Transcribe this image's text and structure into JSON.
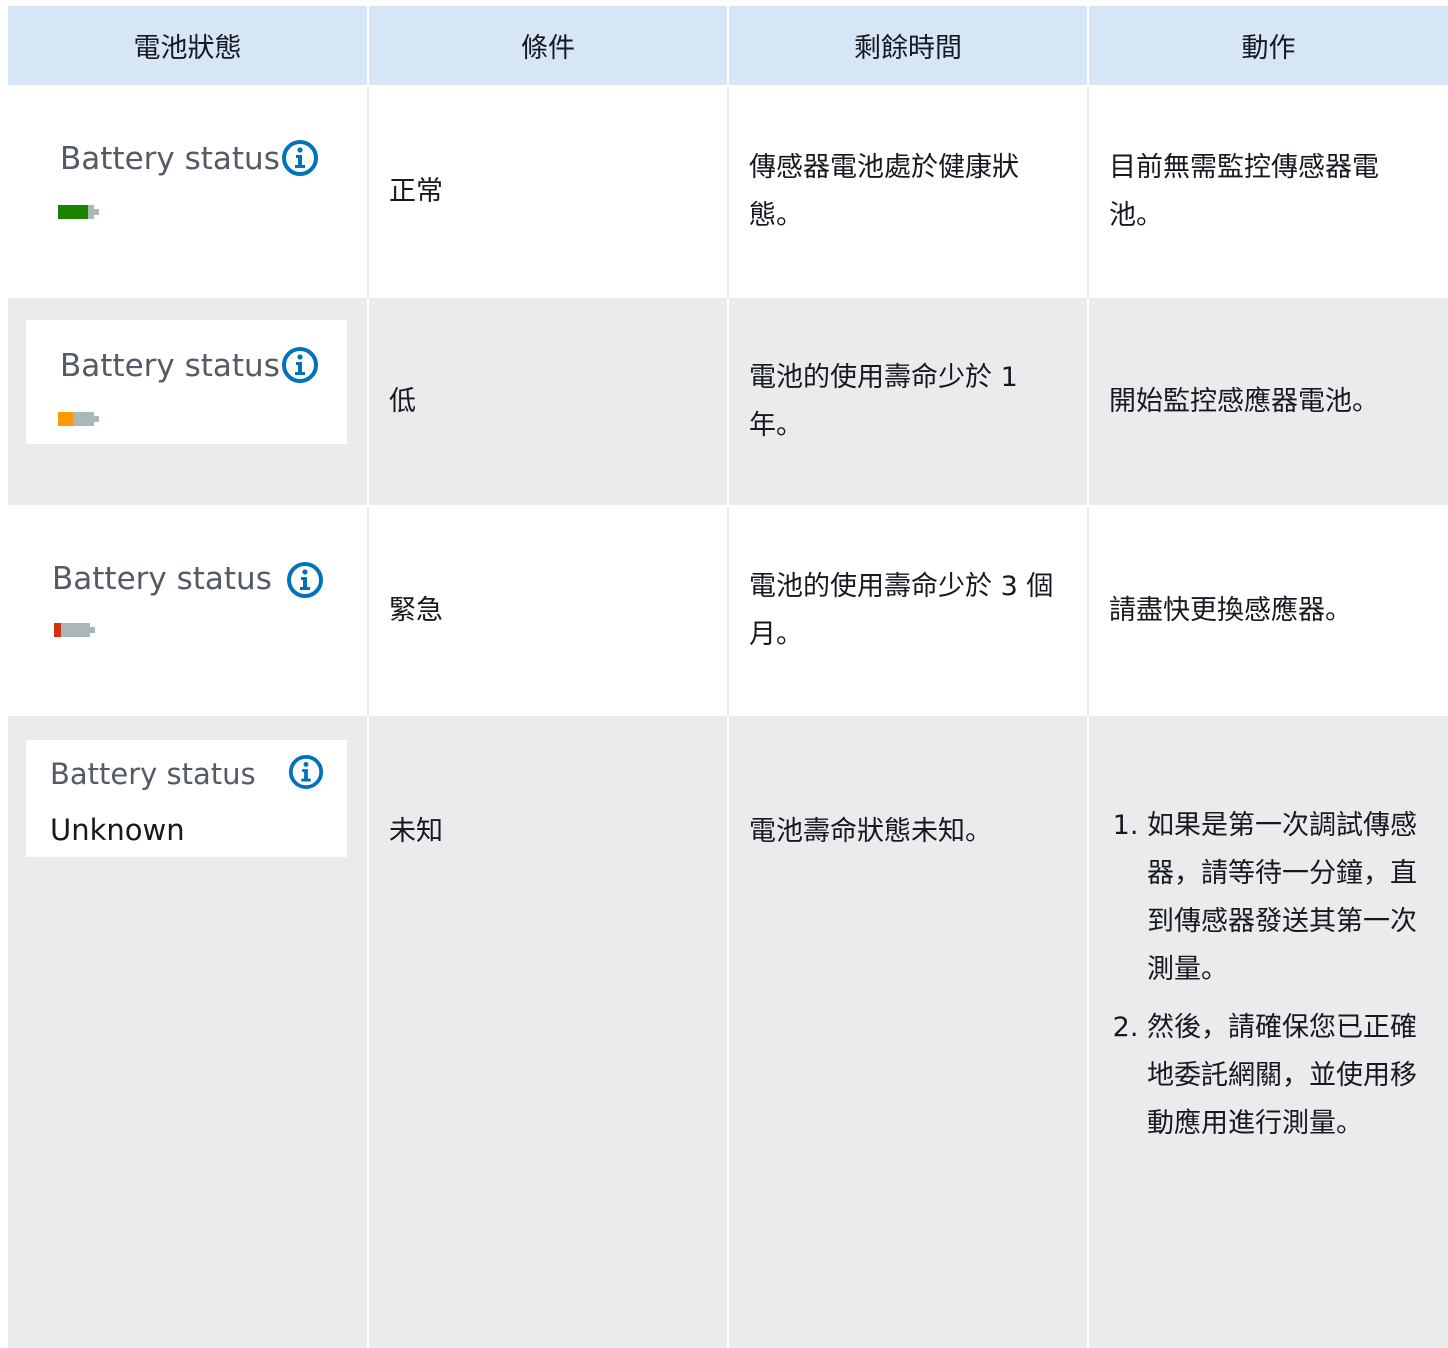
{
  "headers": [
    "電池狀態",
    "條件",
    "剩餘時間",
    "動作"
  ],
  "card_label": "Battery status",
  "colors": {
    "green": "#1d8102",
    "orange": "#ff9900",
    "red": "#d13212",
    "info": "#0073bb"
  },
  "rows": [
    {
      "level": "healthy",
      "condition": "正常",
      "remaining": "傳感器電池處於健康狀態。",
      "action": "目前無需監控傳感器電池。"
    },
    {
      "level": "low",
      "condition": "低",
      "remaining": "電池的使用壽命少於 1 年。",
      "action": "開始監控感應器電池。"
    },
    {
      "level": "critical",
      "condition": "緊急",
      "remaining": "電池的使用壽命少於 3 個月。",
      "action": "請盡快更換感應器。"
    },
    {
      "level": "unknown",
      "status_text": "Unknown",
      "condition": "未知",
      "remaining": "電池壽命狀態未知。",
      "actions": [
        "如果是第一次調試傳感器，請等待一分鐘，直到傳感器發送其第一次測量。",
        "然後，請確保您已正確地委託網關，並使用移動應用進行測量。"
      ]
    }
  ]
}
